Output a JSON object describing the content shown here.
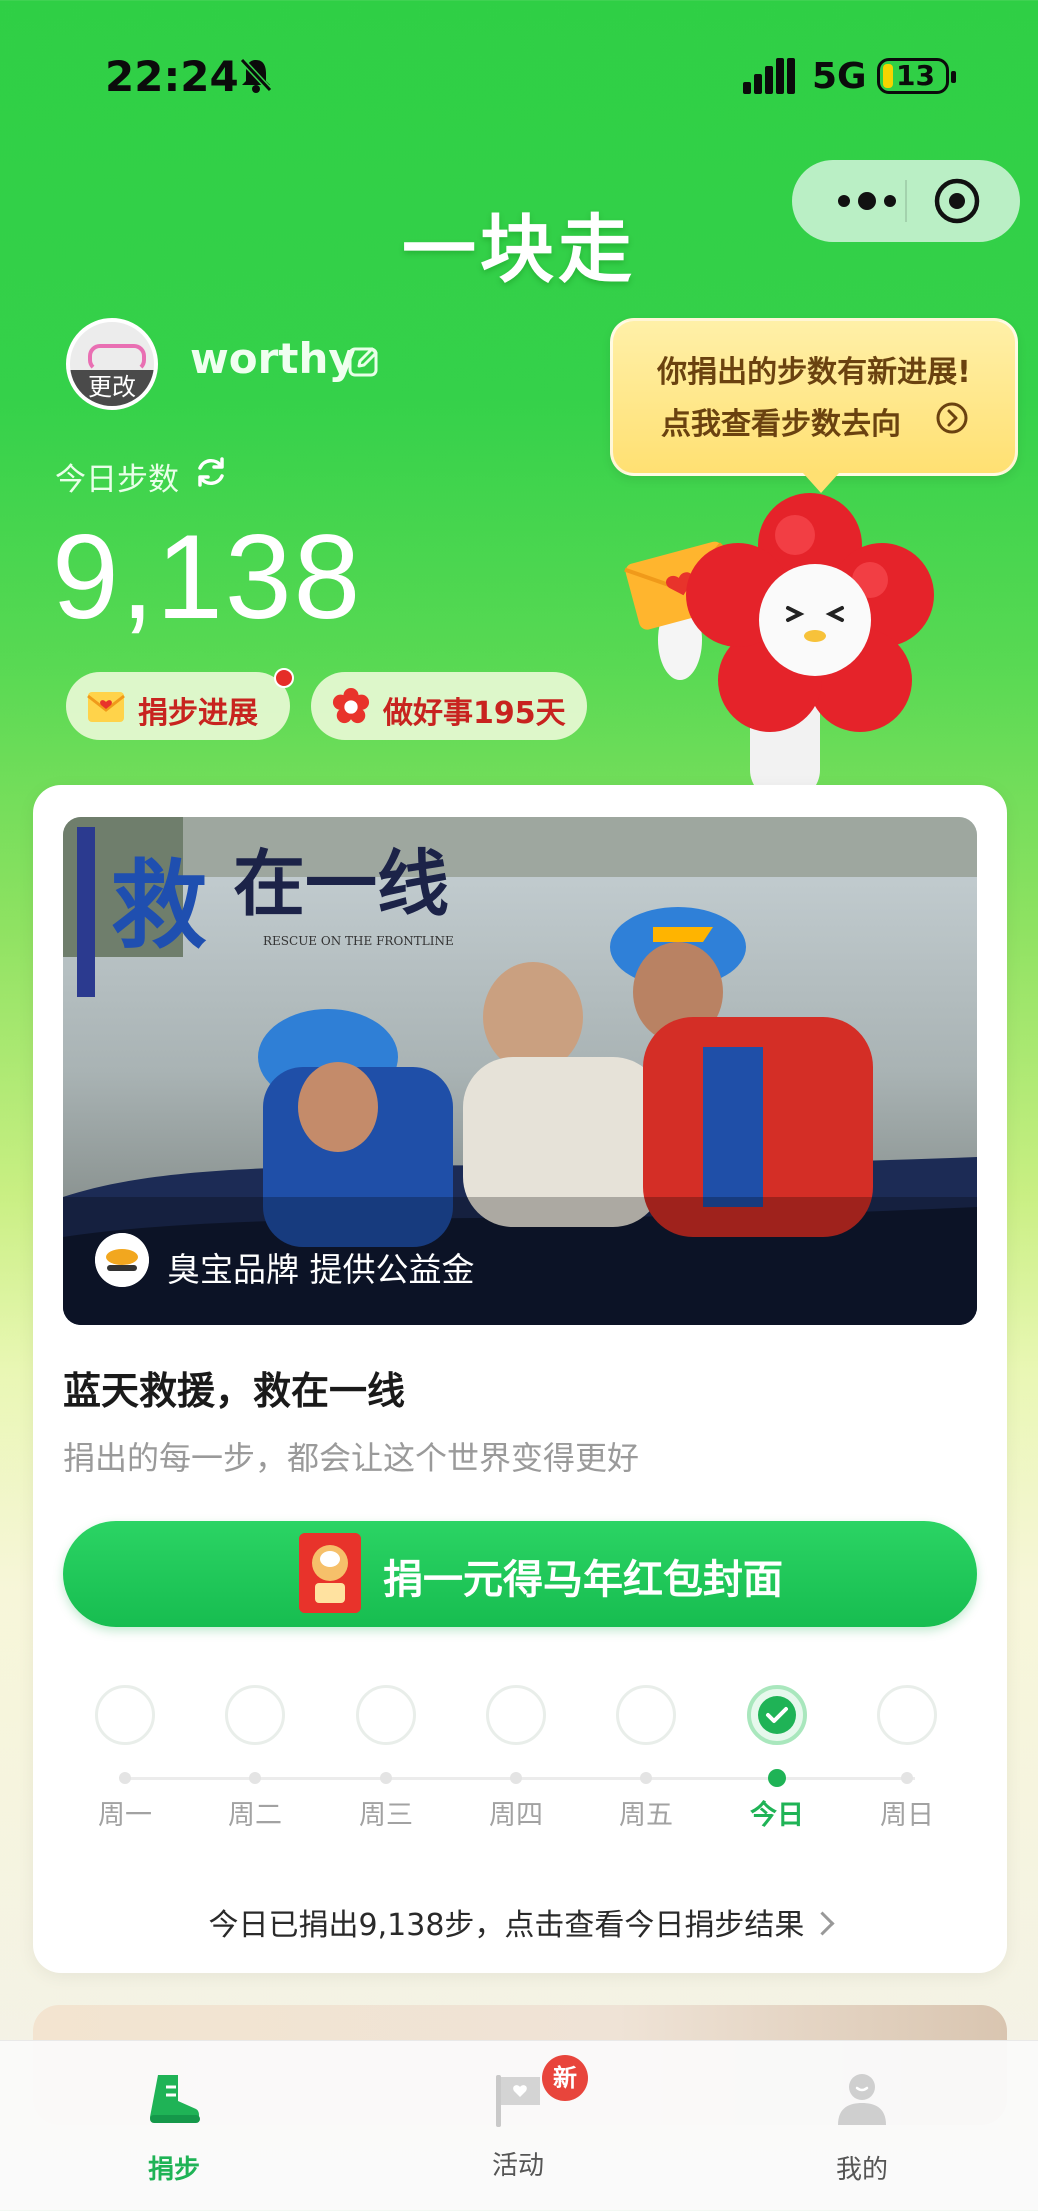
{
  "status_bar": {
    "time": "22:24",
    "network": "5G",
    "battery": "13"
  },
  "app": {
    "title": "一块走"
  },
  "profile": {
    "change_label": "更改",
    "username": "worthy"
  },
  "steps": {
    "label": "今日步数",
    "count": "9,138"
  },
  "pills": {
    "progress": "捐步进展",
    "good_days": "做好事195天"
  },
  "bubble": {
    "line1": "你捐出的步数有新进展!",
    "line2": "点我查看步数去向"
  },
  "project": {
    "banner_title_main": "救",
    "banner_title_rest": "在一线",
    "banner_subtitle": "RESCUE ON THE FRONTLINE",
    "sponsor": "臭宝品牌 提供公益金",
    "title": "蓝天救援，救在一线",
    "subtitle": "捐出的每一步，都会让这个世界变得更好",
    "donate_button": "捐一元得马年红包封面"
  },
  "week": {
    "days": [
      {
        "name": "周一",
        "done": false
      },
      {
        "name": "周二",
        "done": false
      },
      {
        "name": "周三",
        "done": false
      },
      {
        "name": "周四",
        "done": false
      },
      {
        "name": "周五",
        "done": false
      },
      {
        "name": "今日",
        "done": true
      },
      {
        "name": "周日",
        "done": false
      }
    ],
    "summary": "今日已捐出9,138步，点击查看今日捐步结果"
  },
  "tabbar": {
    "items": [
      {
        "label": "捐步",
        "active": true,
        "icon": "shoe-icon"
      },
      {
        "label": "活动",
        "active": false,
        "icon": "flag-icon",
        "badge": "新"
      },
      {
        "label": "我的",
        "active": false,
        "icon": "person-icon"
      }
    ]
  },
  "colors": {
    "brand_green": "#1fb356",
    "accent_red": "#c8231f"
  }
}
